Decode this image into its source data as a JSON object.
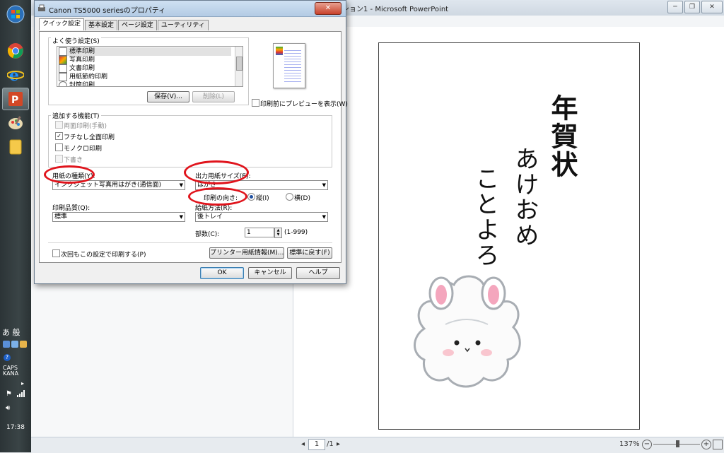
{
  "taskbar": {
    "clock": "17:38",
    "ime_label": "あ 般",
    "caps_label": "CAPS",
    "kana_label": "KANA"
  },
  "ppt": {
    "title": "ション1 - Microsoft PowerPoint",
    "zoom": "137%",
    "page_current": "1",
    "page_total": "/1",
    "slide_line1": "年賀状",
    "slide_line2": "あけおめ",
    "slide_line3": "ことよろ"
  },
  "dialog": {
    "title": "Canon TS5000 seriesのプロパティ",
    "close": "✕",
    "tabs": [
      "クイック設定",
      "基本設定",
      "ページ設定",
      "ユーティリティ"
    ],
    "frequent_label": "よく使う設定(S)",
    "frequent_items": [
      "標準印刷",
      "写真印刷",
      "文書印刷",
      "用紙節約印刷",
      "封筒印刷"
    ],
    "save_button": "保存(V)...",
    "delete_button": "削除(L)",
    "preview_check": "印刷前にプレビューを表示(W)",
    "extra_label": "追加する機能(T)",
    "extra_items": [
      "両面印刷(手動)",
      "フチなし全面印刷",
      "モノクロ印刷",
      "下書き"
    ],
    "media_label": "用紙の種類(Y):",
    "media_value": "インクジェット写真用はがき(通信面)",
    "quality_label": "印刷品質(Q):",
    "quality_value": "標準",
    "outsize_label": "出力用紙サイズ(E):",
    "outsize_value": "はがき",
    "orient_label": "印刷の向き:",
    "orient_portrait": "縦(I)",
    "orient_landscape": "横(D)",
    "source_label": "給紙方法(R):",
    "source_value": "後トレイ",
    "copies_label": "部数(C):",
    "copies_value": "1",
    "copies_range": "(1-999)",
    "always_check": "次回もこの設定で印刷する(P)",
    "media_info_button": "プリンター用紙情報(M)...",
    "defaults_button": "標準に戻す(F)",
    "ok": "OK",
    "cancel": "キャンセル",
    "help": "ヘルプ"
  }
}
